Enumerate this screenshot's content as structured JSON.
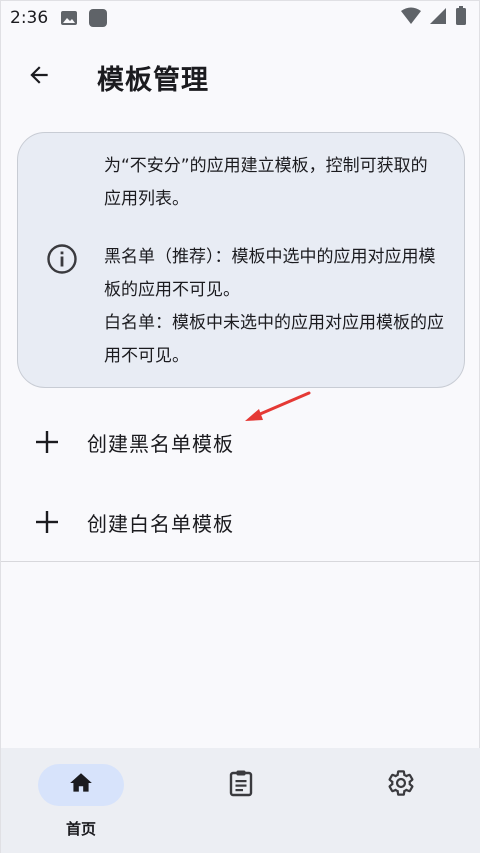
{
  "status_bar": {
    "time": "2:36",
    "icons": [
      "image-icon",
      "app-square-icon",
      "wifi-icon",
      "signal-icon",
      "battery-icon"
    ]
  },
  "header": {
    "title": "模板管理",
    "back_icon": "arrow-back-icon"
  },
  "info_card": {
    "icon": "info-icon",
    "intro": "为“不安分”的应用建立模板，控制可获取的应用列表。",
    "blacklist_desc": "黑名单（推荐）：模板中选中的应用对应用模板的应用不可见。",
    "whitelist_desc": "白名单：模板中未选中的应用对应用模板的应用不可见。"
  },
  "actions": [
    {
      "label": "创建黑名单模板",
      "icon": "plus-icon"
    },
    {
      "label": "创建白名单模板",
      "icon": "plus-icon"
    }
  ],
  "annotation": {
    "icon": "red-arrow-icon",
    "color": "#e53935"
  },
  "bottom_nav": {
    "items": [
      {
        "label": "首页",
        "icon": "home-icon",
        "selected": true
      },
      {
        "label": "",
        "icon": "clipboard-icon",
        "selected": false
      },
      {
        "label": "",
        "icon": "gear-icon",
        "selected": false
      }
    ]
  },
  "colors": {
    "background": "#f9f9fc",
    "card": "#e8ecf4",
    "nav_bar": "#eceef3",
    "nav_selected_pill": "#d7e3fb",
    "text": "#1b1b1f"
  }
}
